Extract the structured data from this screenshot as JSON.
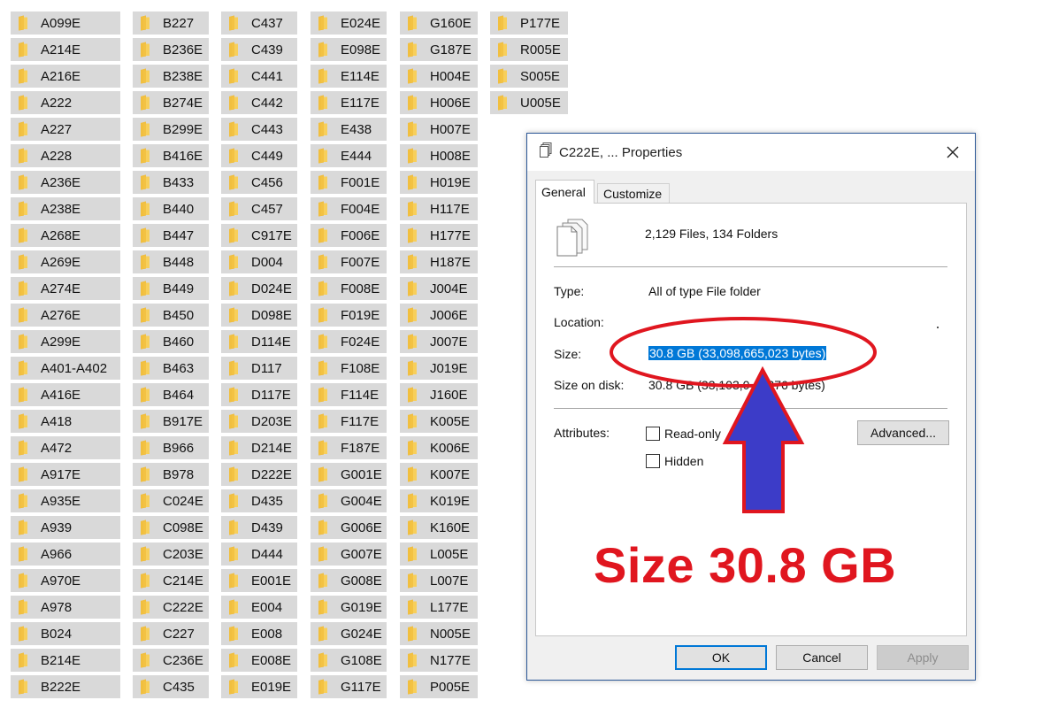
{
  "folder_columns": [
    [
      "A099E",
      "A214E",
      "A216E",
      "A222",
      "A227",
      "A228",
      "A236E",
      "A238E",
      "A268E",
      "A269E",
      "A274E",
      "A276E",
      "A299E",
      "A401-A402",
      "A416E",
      "A418",
      "A472",
      "A917E",
      "A935E",
      "A939",
      "A966",
      "A970E",
      "A978",
      "B024",
      "B214E",
      "B222E"
    ],
    [
      "B227",
      "B236E",
      "B238E",
      "B274E",
      "B299E",
      "B416E",
      "B433",
      "B440",
      "B447",
      "B448",
      "B449",
      "B450",
      "B460",
      "B463",
      "B464",
      "B917E",
      "B966",
      "B978",
      "C024E",
      "C098E",
      "C203E",
      "C214E",
      "C222E",
      "C227",
      "C236E",
      "C435"
    ],
    [
      "C437",
      "C439",
      "C441",
      "C442",
      "C443",
      "C449",
      "C456",
      "C457",
      "C917E",
      "D004",
      "D024E",
      "D098E",
      "D114E",
      "D117",
      "D117E",
      "D203E",
      "D214E",
      "D222E",
      "D435",
      "D439",
      "D444",
      "E001E",
      "E004",
      "E008",
      "E008E",
      "E019E"
    ],
    [
      "E024E",
      "E098E",
      "E114E",
      "E117E",
      "E438",
      "E444",
      "F001E",
      "F004E",
      "F006E",
      "F007E",
      "F008E",
      "F019E",
      "F024E",
      "F108E",
      "F114E",
      "F117E",
      "F187E",
      "G001E",
      "G004E",
      "G006E",
      "G007E",
      "G008E",
      "G019E",
      "G024E",
      "G108E",
      "G117E"
    ],
    [
      "G160E",
      "G187E",
      "H004E",
      "H006E",
      "H007E",
      "H008E",
      "H019E",
      "H117E",
      "H177E",
      "H187E",
      "J004E",
      "J006E",
      "J007E",
      "J019E",
      "J160E",
      "K005E",
      "K006E",
      "K007E",
      "K019E",
      "K160E",
      "L005E",
      "L007E",
      "L177E",
      "N005E",
      "N177E",
      "P005E"
    ],
    [
      "P177E",
      "R005E",
      "S005E",
      "U005E"
    ]
  ],
  "dialog": {
    "title": "C222E, ... Properties",
    "tabs": [
      "General",
      "Customize"
    ],
    "summary": "2,129 Files, 134 Folders",
    "type_label": "Type:",
    "type_value": "All of type File folder",
    "location_label": "Location:",
    "location_value": "",
    "size_label": "Size:",
    "size_value": "30.8 GB (33,098,665,023 bytes)",
    "size_on_disk_label": "Size on disk:",
    "size_on_disk_value": "30.8 GB (33,103,0",
    "size_on_disk_value_tail": "376 bytes)",
    "attributes_label": "Attributes:",
    "readonly_label": "Read-only",
    "hidden_label": "Hidden",
    "advanced_button": "Advanced...",
    "ok_button": "OK",
    "cancel_button": "Cancel",
    "apply_button": "Apply"
  },
  "annotation": {
    "headline": "Size 30.8 GB",
    "color": "#e0161f",
    "arrow_fill": "#3c3cc8"
  },
  "colors": {
    "folder_item_bg": "#d9d9d9",
    "folder_icon": "#f5c542",
    "selection": "#0078d7",
    "dialog_border": "#2b5797"
  }
}
